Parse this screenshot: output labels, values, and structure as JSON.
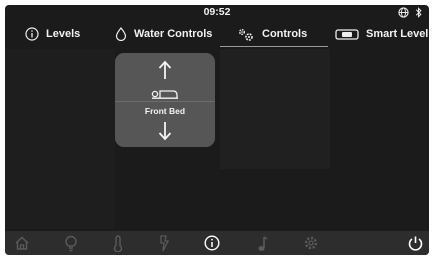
{
  "status": {
    "time": "09:52",
    "icons": [
      "globe-icon",
      "bluetooth-icon"
    ]
  },
  "tabs": [
    {
      "label": "Levels",
      "icon": "info-circle-icon",
      "active": false
    },
    {
      "label": "Water Controls",
      "icon": "water-drop-icon",
      "active": false
    },
    {
      "label": "Controls",
      "icon": "gears-icon",
      "active": true
    },
    {
      "label": "Smart Level",
      "icon": "level-gauge-icon",
      "active": false
    }
  ],
  "control": {
    "label": "Front Bed",
    "up_icon": "arrow-up-icon",
    "down_icon": "arrow-down-icon",
    "bed_icon": "bed-icon"
  },
  "nav": {
    "items": [
      "home-icon",
      "lightbulb-icon",
      "thermometer-icon",
      "power-bolt-icon",
      "info-icon",
      "music-icon",
      "settings-gear-icon"
    ],
    "active": "info-icon",
    "power_icon": "power-icon"
  },
  "colors": {
    "background": "#1b1b1b",
    "card": "#565656",
    "nav_bar": "#2d2d2d",
    "nav_inactive": "#5a5a5a",
    "nav_active": "#ffffff",
    "text": "#f2f2f2"
  }
}
